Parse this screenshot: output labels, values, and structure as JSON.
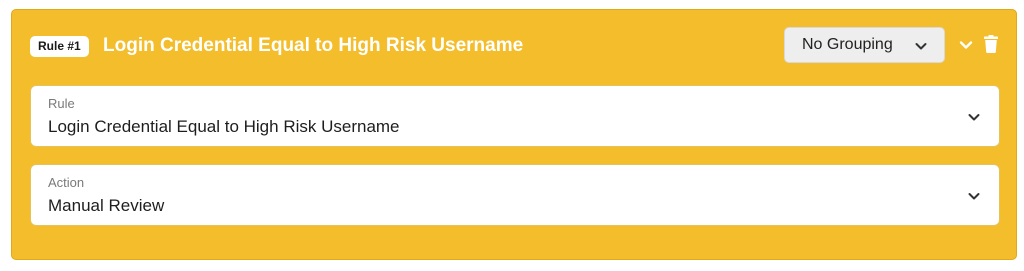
{
  "rule_card": {
    "badge": "Rule #1",
    "title": "Login Credential Equal to High Risk Username",
    "background_color": "#f4bd2c",
    "grouping": {
      "selected": "No Grouping",
      "icon": "chevron-down-icon"
    },
    "collapse_icon": "chevron-down-icon",
    "delete_icon": "trash-icon"
  },
  "fields": {
    "rule": {
      "label": "Rule",
      "value": "Login Credential Equal to High Risk Username",
      "icon": "chevron-down-icon"
    },
    "action": {
      "label": "Action",
      "value": "Manual Review",
      "icon": "chevron-down-icon"
    }
  }
}
